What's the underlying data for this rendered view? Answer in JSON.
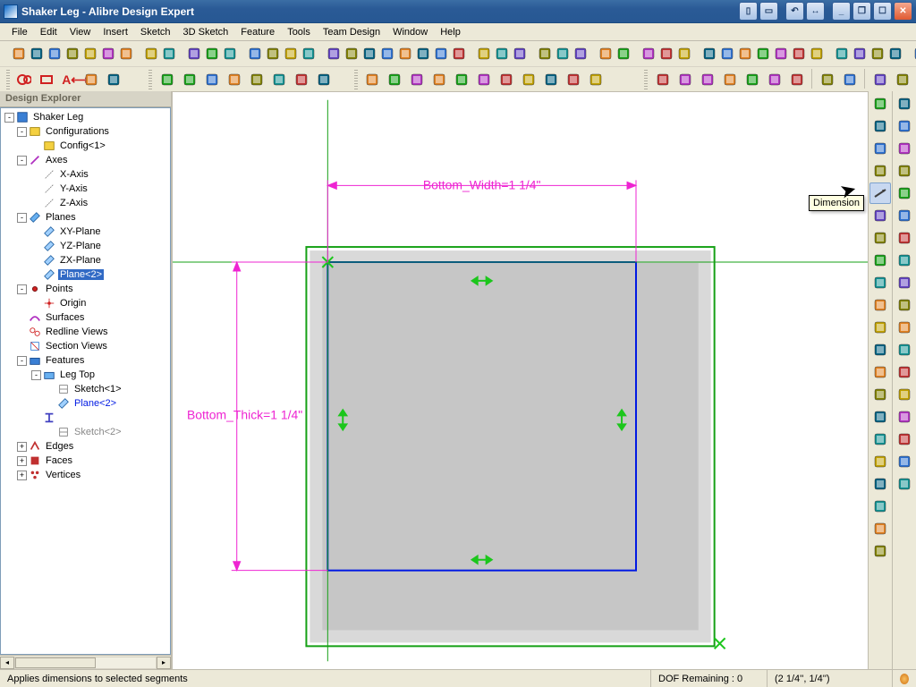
{
  "window": {
    "title": "Shaker Leg - Alibre Design Expert"
  },
  "menubar": [
    "File",
    "Edit",
    "View",
    "Insert",
    "Sketch",
    "3D Sketch",
    "Feature",
    "Tools",
    "Team Design",
    "Window",
    "Help"
  ],
  "explorer": {
    "title": "Design Explorer",
    "tree": [
      {
        "depth": 0,
        "exp": "-",
        "icon": "part",
        "label": "Shaker Leg"
      },
      {
        "depth": 1,
        "exp": "-",
        "icon": "cfg",
        "label": "Configurations"
      },
      {
        "depth": 2,
        "exp": "",
        "icon": "cfg1",
        "label": "Config<1>"
      },
      {
        "depth": 1,
        "exp": "-",
        "icon": "axis",
        "label": "Axes"
      },
      {
        "depth": 2,
        "exp": "",
        "icon": "axis1",
        "label": "X-Axis"
      },
      {
        "depth": 2,
        "exp": "",
        "icon": "axis1",
        "label": "Y-Axis"
      },
      {
        "depth": 2,
        "exp": "",
        "icon": "axis1",
        "label": "Z-Axis"
      },
      {
        "depth": 1,
        "exp": "-",
        "icon": "plane",
        "label": "Planes"
      },
      {
        "depth": 2,
        "exp": "",
        "icon": "plane1",
        "label": "XY-Plane"
      },
      {
        "depth": 2,
        "exp": "",
        "icon": "plane1",
        "label": "YZ-Plane"
      },
      {
        "depth": 2,
        "exp": "",
        "icon": "plane1",
        "label": "ZX-Plane"
      },
      {
        "depth": 2,
        "exp": "",
        "icon": "plane1",
        "label": "Plane<2>",
        "sel": true
      },
      {
        "depth": 1,
        "exp": "-",
        "icon": "points",
        "label": "Points"
      },
      {
        "depth": 2,
        "exp": "",
        "icon": "origin",
        "label": "Origin"
      },
      {
        "depth": 1,
        "exp": "",
        "icon": "surf",
        "label": "Surfaces"
      },
      {
        "depth": 1,
        "exp": "",
        "icon": "redline",
        "label": "Redline Views"
      },
      {
        "depth": 1,
        "exp": "",
        "icon": "section",
        "label": "Section Views"
      },
      {
        "depth": 1,
        "exp": "-",
        "icon": "feat",
        "label": "Features"
      },
      {
        "depth": 2,
        "exp": "-",
        "icon": "legtop",
        "label": "Leg Top"
      },
      {
        "depth": 3,
        "exp": "",
        "icon": "sketch",
        "label": "Sketch<1>"
      },
      {
        "depth": 3,
        "exp": "",
        "icon": "plane1",
        "label": "Plane<2>",
        "blue": true
      },
      {
        "depth": 2,
        "exp": "",
        "icon": "ibeam",
        "label": ""
      },
      {
        "depth": 3,
        "exp": "",
        "icon": "sketch",
        "label": "Sketch<2>",
        "grey": true
      },
      {
        "depth": 1,
        "exp": "+",
        "icon": "edges",
        "label": "Edges"
      },
      {
        "depth": 1,
        "exp": "+",
        "icon": "faces",
        "label": "Faces"
      },
      {
        "depth": 1,
        "exp": "+",
        "icon": "verts",
        "label": "Vertices"
      }
    ]
  },
  "sketch": {
    "dim_width_label": "Bottom_Width=1 1/4\"",
    "dim_thick_label": "Bottom_Thick=1 1/4\""
  },
  "tooltip": "Dimension",
  "status": {
    "hint": "Applies dimensions to selected segments",
    "dof": "DOF Remaining : 0",
    "coords": "(2 1/4'', 1/4'')"
  },
  "right_toolbar_left": [
    "select",
    "plus",
    "line",
    "line2",
    "dim",
    "fillet",
    "circle",
    "curve",
    "rect",
    "spline",
    "point",
    "gear",
    "capture",
    "hline",
    "cross",
    "arc",
    "tangent",
    "target",
    "info",
    "mirror",
    "wall"
  ],
  "right_toolbar_right": [
    "extrude",
    "revolve",
    "cut",
    "sweep",
    "loft",
    "shell",
    "hole",
    "convert",
    "pattern",
    "mirrorf",
    "rib",
    "axisf",
    "planef",
    "datumf",
    "section",
    "measure",
    "fx",
    "analyze"
  ],
  "toolbar_row1": [
    "new",
    "open",
    "save",
    "print",
    "cut",
    "copy",
    "paste",
    "sep",
    "undo",
    "redo",
    "sep",
    "move",
    "rotate",
    "scale",
    "sep",
    "axis",
    "plane",
    "pt3",
    "pt2",
    "sep",
    "ext",
    "rev",
    "swp",
    "lft",
    "shl",
    "cut1",
    "cut2",
    "hol",
    "sep",
    "rib",
    "fil",
    "chm",
    "sep",
    "mir",
    "patl",
    "patc",
    "sep",
    "sec",
    "msr",
    "sep",
    "shw",
    "hd1",
    "hd2",
    "sep",
    "v1",
    "v2",
    "v3",
    "v4",
    "v5",
    "v6",
    "v7",
    "sep",
    "c1",
    "c2",
    "c3",
    "c4",
    "sep",
    "d1",
    "d2",
    "d3",
    "d4"
  ],
  "toolbar_row2_a": [
    "circle2",
    "rect2",
    "A",
    "arc3",
    "line3"
  ],
  "toolbar_row2_b": [
    "plane2",
    "ax2",
    "cfg2",
    "cfg3",
    "eq",
    "tbl",
    "warn",
    "scale2"
  ],
  "toolbar_row2_c": [
    "sel",
    "box",
    "zin",
    "zwin",
    "zall",
    "prev",
    "next",
    "proj",
    "cyl",
    "wall2",
    "block"
  ],
  "toolbar_row2_d": [
    "wf",
    "hline2",
    "shd",
    "shd2",
    "shd3",
    "shd4",
    "shd5",
    "sep",
    "iso",
    "plane3",
    "sep",
    "exp1",
    "exp2"
  ]
}
